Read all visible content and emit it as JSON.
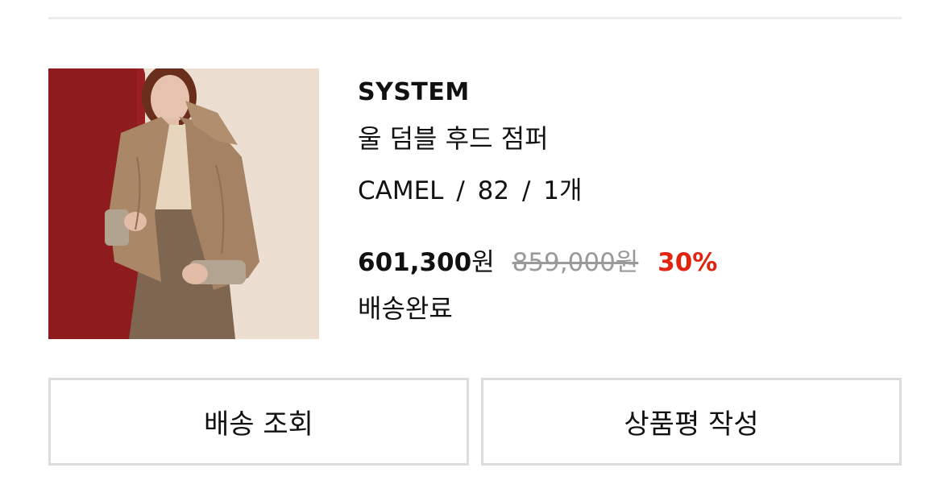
{
  "order_item": {
    "image_alt": "울 덤블 후드 점퍼",
    "brand": "SYSTEM",
    "name": "울 덤블 후드 점퍼",
    "option": {
      "color": "CAMEL",
      "size": "82",
      "quantity": "1개",
      "separator": "/"
    },
    "price": {
      "sale": "601,300",
      "sale_unit": "원",
      "original": "859,000원",
      "discount": "30%"
    },
    "status": "배송완료"
  },
  "actions": {
    "track_label": "배송 조회",
    "review_label": "상품평 작성"
  },
  "colors": {
    "discount": "#e0240f",
    "original_price": "#9a9a9a",
    "border": "#dcdcdc"
  }
}
